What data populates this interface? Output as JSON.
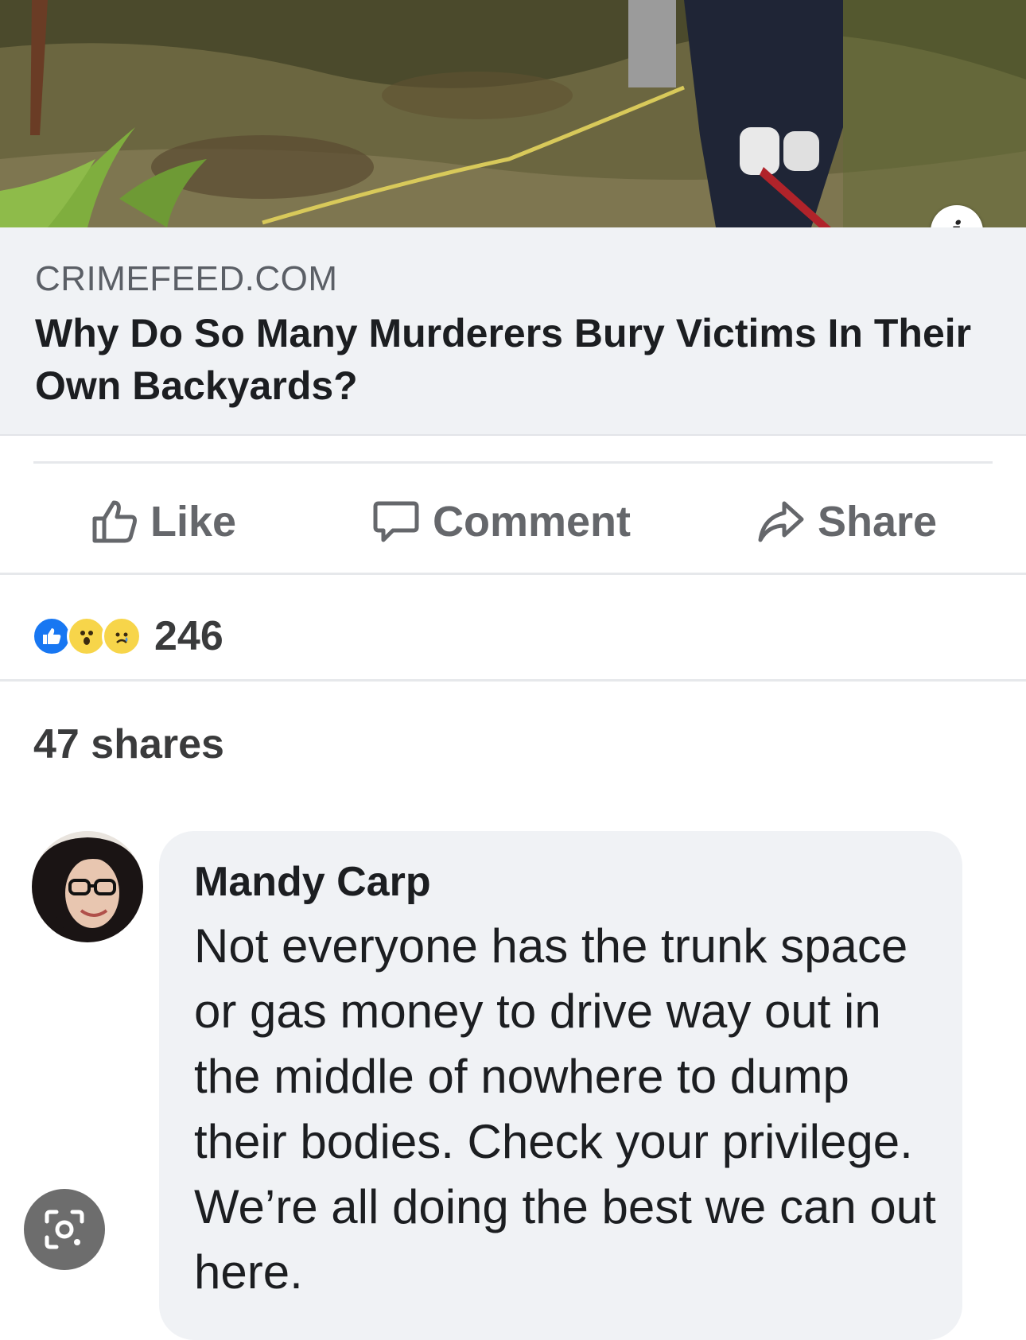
{
  "link_preview": {
    "domain": "CRIMEFEED.COM",
    "headline": "Why Do So Many Murderers Bury Victims In Their Own Backyards?",
    "info_glyph": "i"
  },
  "actions": {
    "like_label": "Like",
    "comment_label": "Comment",
    "share_label": "Share"
  },
  "reactions": {
    "icons": [
      "like-icon",
      "wow-icon",
      "sad-icon"
    ],
    "count": "246"
  },
  "shares": "47 shares",
  "comment": {
    "author": "Mandy Carp",
    "text": "Not everyone has the trunk space or gas money to drive way out in the middle of nowhere to dump their bodies. Check your privilege. We’re all doing the best we can out here."
  },
  "overlay": {
    "lens_icon": "visual-search-icon"
  },
  "colors": {
    "link_box_bg": "#f0f2f5",
    "action_text": "#65676b",
    "like_blue": "#1877f2",
    "reaction_yellow": "#f7d54a",
    "bubble_bg": "#f0f2f5"
  }
}
